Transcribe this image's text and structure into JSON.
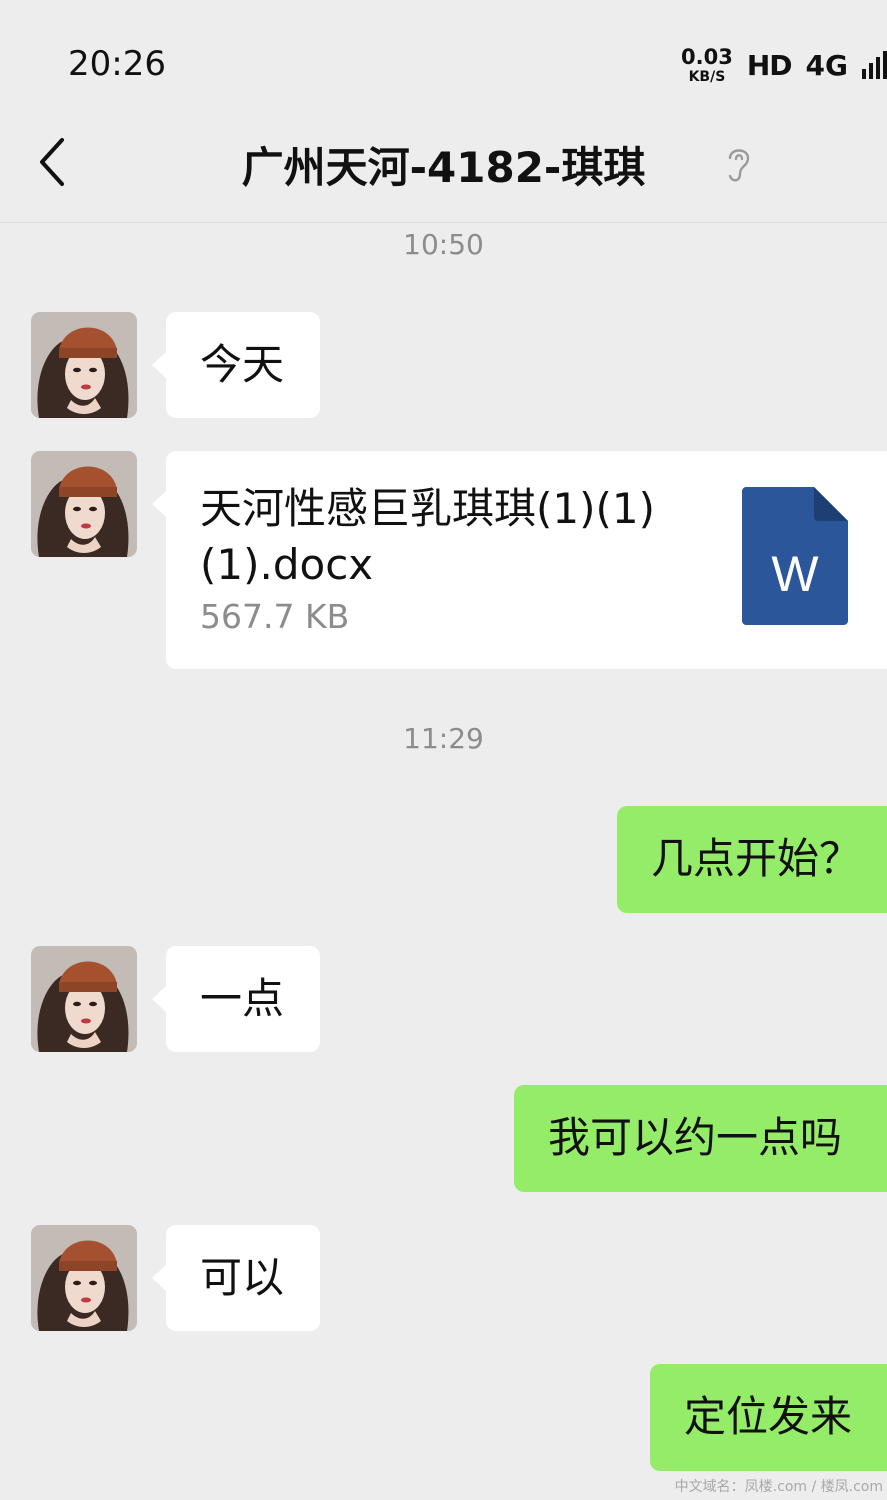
{
  "status_bar": {
    "time": "20:26",
    "speed_value": "0.03",
    "speed_unit": "KB/S",
    "hd": "HD",
    "network": "4G"
  },
  "header": {
    "title": "广州天河-4182-琪琪",
    "back_icon": "chevron-left-icon",
    "ear_icon": "earpiece-mode-icon"
  },
  "messages": [
    {
      "kind": "timestamp",
      "text": "10:50"
    },
    {
      "kind": "text",
      "side": "left",
      "text": "今天"
    },
    {
      "kind": "file",
      "side": "left",
      "name": "天河性感巨乳琪琪(1)(1)(1).docx",
      "size": "567.7 KB",
      "icon": "word-document-icon",
      "icon_letter": "W",
      "icon_color": "#2b579a"
    },
    {
      "kind": "timestamp",
      "text": "11:29"
    },
    {
      "kind": "text",
      "side": "right",
      "text": "几点开始？"
    },
    {
      "kind": "text",
      "side": "left",
      "text": "一点"
    },
    {
      "kind": "text",
      "side": "right",
      "text": "我可以约一点吗"
    },
    {
      "kind": "text",
      "side": "left",
      "text": "可以"
    },
    {
      "kind": "text",
      "side": "right",
      "text": "定位发来"
    }
  ],
  "colors": {
    "background": "#ededed",
    "incoming_bubble": "#ffffff",
    "outgoing_bubble": "#95ec69"
  },
  "watermark": "中文域名：凤楼.com / 楼凤.com"
}
